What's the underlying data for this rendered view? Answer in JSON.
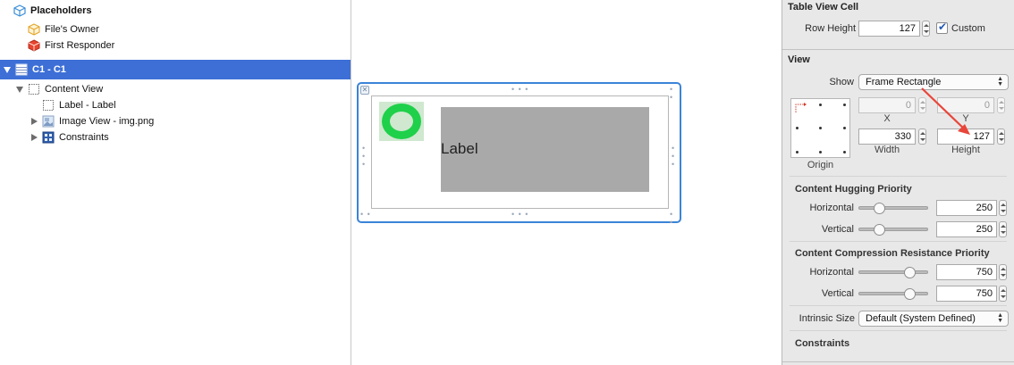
{
  "outline": {
    "placeholders_label": "Placeholders",
    "files_owner_label": "File's Owner",
    "first_responder_label": "First Responder",
    "cell_label": "C1 - C1",
    "content_view_label": "Content View",
    "label_item_label": "Label - Label",
    "image_view_label": "Image View - img.png",
    "constraints_label": "Constraints"
  },
  "canvas": {
    "label_text": "Label"
  },
  "inspector": {
    "table_view_cell": {
      "title": "Table View Cell",
      "row_height_label": "Row Height",
      "row_height_value": "127",
      "custom_label": "Custom",
      "custom_checked": true
    },
    "view": {
      "title": "View",
      "show_label": "Show",
      "show_value": "Frame Rectangle",
      "x_value": "0",
      "y_value": "0",
      "x_label": "X",
      "y_label": "Y",
      "width_value": "330",
      "height_value": "127",
      "width_label": "Width",
      "height_label": "Height",
      "origin_label": "Origin"
    },
    "hugging": {
      "title": "Content Hugging Priority",
      "horizontal_label": "Horizontal",
      "horizontal_value": "250",
      "vertical_label": "Vertical",
      "vertical_value": "250"
    },
    "compression": {
      "title": "Content Compression Resistance Priority",
      "horizontal_label": "Horizontal",
      "horizontal_value": "750",
      "vertical_label": "Vertical",
      "vertical_value": "750"
    },
    "intrinsic": {
      "label": "Intrinsic Size",
      "value": "Default (System Defined)"
    },
    "constraints_title": "Constraints"
  },
  "colors": {
    "selection": "#3d6fd6",
    "cell_border": "#3a84d8",
    "image_ring": "#1fd04a",
    "annotation_arrow": "#e8463a"
  }
}
